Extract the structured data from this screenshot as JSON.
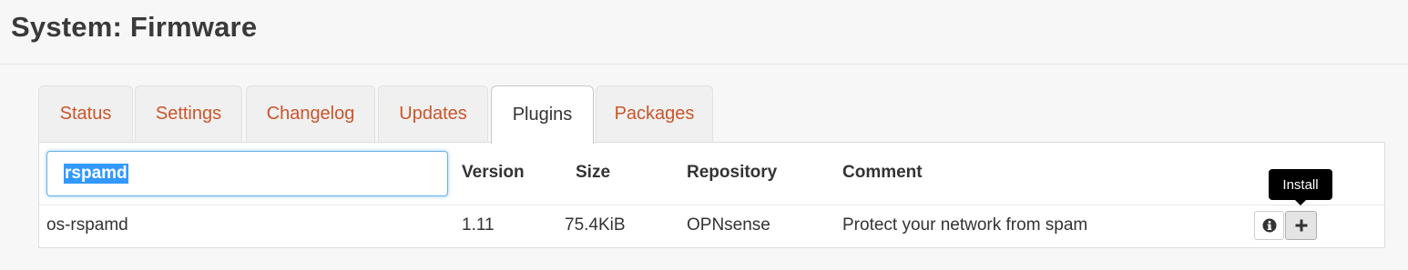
{
  "page": {
    "title": "System: Firmware"
  },
  "tabs": [
    {
      "label": "Status"
    },
    {
      "label": "Settings"
    },
    {
      "label": "Changelog"
    },
    {
      "label": "Updates"
    },
    {
      "label": "Plugins",
      "active": true
    },
    {
      "label": "Packages"
    }
  ],
  "table": {
    "search": {
      "value": "rspamd"
    },
    "columns": [
      "Version",
      "Size",
      "Repository",
      "Comment"
    ],
    "rows": [
      {
        "name": "os-rspamd",
        "version": "1.11",
        "size": "75.4KiB",
        "repository": "OPNsense",
        "comment": "Protect your network from spam"
      }
    ]
  },
  "actions": {
    "info_icon": "info-circle-icon",
    "install_icon": "plus-icon",
    "install_tooltip": "Install"
  },
  "colors": {
    "tab_link": "#c9562b",
    "search_focus": "#66afe9",
    "selection": "#3399ff"
  }
}
